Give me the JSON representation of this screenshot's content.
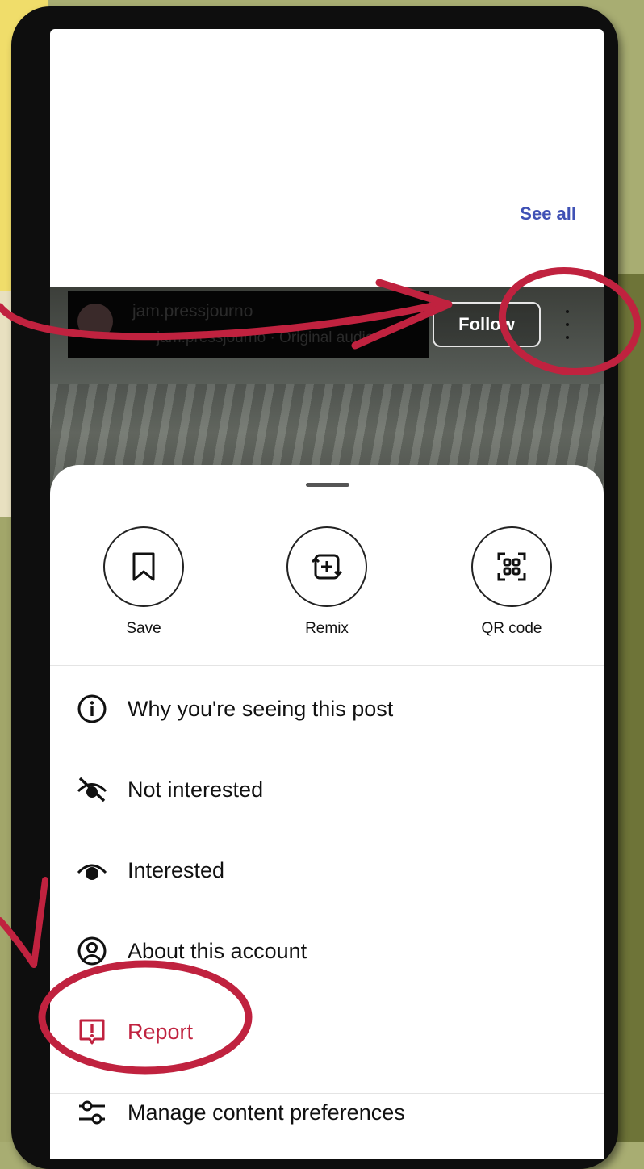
{
  "header": {
    "see_all": "See all"
  },
  "post": {
    "username": "jam.pressjourno",
    "subline": "jam.pressjourno · Original audio",
    "follow_label": "Follow"
  },
  "sheet": {
    "actions": [
      {
        "label": "Save",
        "icon": "bookmark-icon"
      },
      {
        "label": "Remix",
        "icon": "remix-icon"
      },
      {
        "label": "QR code",
        "icon": "qr-code-icon"
      }
    ],
    "items": [
      {
        "label": "Why you're seeing this post",
        "icon": "info-icon"
      },
      {
        "label": "Not interested",
        "icon": "eye-off-icon"
      },
      {
        "label": "Interested",
        "icon": "eye-icon"
      },
      {
        "label": "About this account",
        "icon": "account-icon"
      },
      {
        "label": "Report",
        "icon": "report-icon"
      },
      {
        "label": "Manage content preferences",
        "icon": "sliders-icon"
      }
    ]
  },
  "colors": {
    "annotation": "#c0223f",
    "link": "#3f51b5",
    "report_text": "#c0223f"
  }
}
